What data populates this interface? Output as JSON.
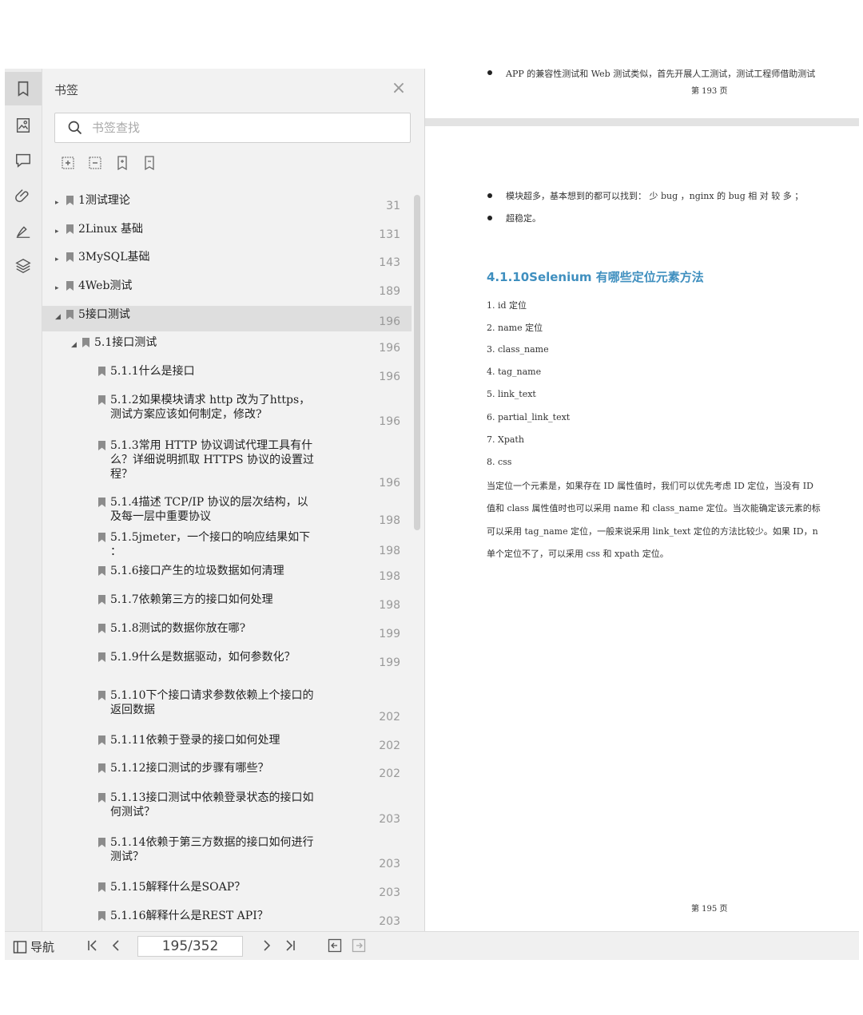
{
  "sidebar": {
    "title": "书签",
    "search_placeholder": "书签查找",
    "icons": [
      "bookmark-icon",
      "image-icon",
      "comment-icon",
      "attachment-icon",
      "signature-icon",
      "layers-icon"
    ],
    "toolbar_icons": [
      "expand-all-icon",
      "collapse-all-icon",
      "add-bookmark-icon",
      "remove-bookmark-icon"
    ],
    "items": [
      {
        "label": "1测试理论",
        "page": "31",
        "level": 0,
        "caret": "▸"
      },
      {
        "label": "2Linux 基础",
        "page": "131",
        "level": 0,
        "caret": "▸"
      },
      {
        "label": "3MySQL基础",
        "page": "143",
        "level": 0,
        "caret": "▸"
      },
      {
        "label": "4Web测试",
        "page": "189",
        "level": 0,
        "caret": "▸"
      },
      {
        "label": "5接口测试",
        "page": "196",
        "level": 0,
        "caret": "◢",
        "selected": true
      },
      {
        "label": "5.1接口测试",
        "page": "196",
        "level": 1,
        "caret": "◢"
      },
      {
        "label": "5.1.1什么是接口",
        "page": "196",
        "level": 2
      },
      {
        "label": "5.1.2如果模块请求 http 改为了https，\n测试方案应该如何制定，修改?",
        "page": "196",
        "level": 2
      },
      {
        "label": "5.1.3常用 HTTP 协议调试代理工具有什\n么？详细说明抓取 HTTPS 协议的设置过\n程？",
        "page": "196",
        "level": 2
      },
      {
        "label": "5.1.4描述 TCP/IP 协议的层次结构，以\n及每一层中重要协议",
        "page": "198",
        "level": 2
      },
      {
        "label": "5.1.5jmeter，一个接口的响应结果如下\n：",
        "page": "198",
        "level": 2
      },
      {
        "label": "5.1.6接口产生的垃圾数据如何清理",
        "page": "198",
        "level": 2
      },
      {
        "label": "5.1.7依赖第三方的接口如何处理",
        "page": "198",
        "level": 2
      },
      {
        "label": "5.1.8测试的数据你放在哪?",
        "page": "199",
        "level": 2
      },
      {
        "label": "5.1.9什么是数据驱动，如何参数化？",
        "page": "199",
        "level": 2
      },
      {
        "label": "5.1.10下个接口请求参数依赖上个接口的\n返回数据",
        "page": "202",
        "level": 2
      },
      {
        "label": "5.1.11依赖于登录的接口如何处理",
        "page": "202",
        "level": 2
      },
      {
        "label": "5.1.12接口测试的步骤有哪些？",
        "page": "202",
        "level": 2
      },
      {
        "label": "5.1.13接口测试中依赖登录状态的接口如\n何测试？",
        "page": "203",
        "level": 2
      },
      {
        "label": "5.1.14依赖于第三方数据的接口如何进行\n测试？",
        "page": "203",
        "level": 2
      },
      {
        "label": "5.1.15解释什么是SOAP？",
        "page": "203",
        "level": 2
      },
      {
        "label": "5.1.16解释什么是REST API？",
        "page": "203",
        "level": 2
      }
    ]
  },
  "statusbar": {
    "nav_label": "导航",
    "page_indicator": "195/352"
  },
  "document": {
    "prev_page_bullet": "APP 的兼容性测试和 Web 测试类似，首先开展人工测试，测试工程师借助测试",
    "prev_page_footer": "第 193 页",
    "bullets": [
      "模块超多，基本想到的都可以找到：  少 bug ，nginx 的 bug 相 对 较 多 ；",
      "超稳定。"
    ],
    "heading": "4.1.10Selenium 有哪些定位元素方法",
    "list": [
      "1.  id 定位",
      "2.  name 定位",
      "3.  class_name",
      "4.  tag_name",
      "5.  link_text",
      "6.  partial_link_text",
      "7.  Xpath",
      "8.  css"
    ],
    "paragraph": [
      "当定位一个元素是，如果存在 ID 属性值时，我们可以优先考虑 ID 定位，当没有 ID",
      "值和 class 属性值时也可以采用 name 和 class_name 定位。当次能确定该元素的标",
      "可以采用 tag_name 定位，一般来说采用 link_text 定位的方法比较少。如果 ID，n",
      "单个定位不了，可以采用 css 和 xpath 定位。"
    ],
    "page_footer": "第 195 页"
  }
}
